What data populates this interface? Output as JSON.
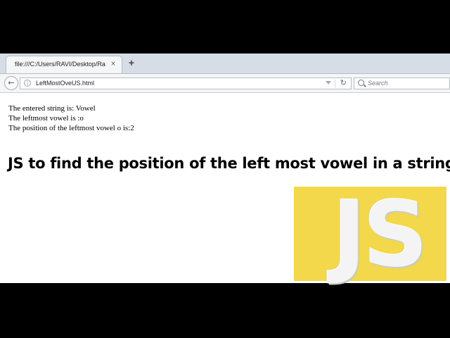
{
  "browser": {
    "tab": {
      "title": "file:///C:/Users/RAVI/Desktop/Ra",
      "close_glyph": "×"
    },
    "newtab_glyph": "+",
    "url": "LeftMostOveUS.html",
    "search_placeholder": "Search",
    "icons": {
      "back": "back-arrow-icon",
      "info": "info-icon",
      "dropdown": "dropdown-arrow-icon",
      "reload": "reload-icon",
      "search": "search-icon"
    },
    "glyphs": {
      "back": "←",
      "info": "i",
      "reload": "↻"
    }
  },
  "page": {
    "lines": [
      "The entered string is: Vowel",
      "The leftmost vowel is :o",
      "The position of the leftmost vowel o is:2"
    ],
    "heading": "JS to find the position of the left most vowel in a string",
    "logo_text": "JS",
    "colors": {
      "logo_background": "#f2d84a"
    }
  }
}
